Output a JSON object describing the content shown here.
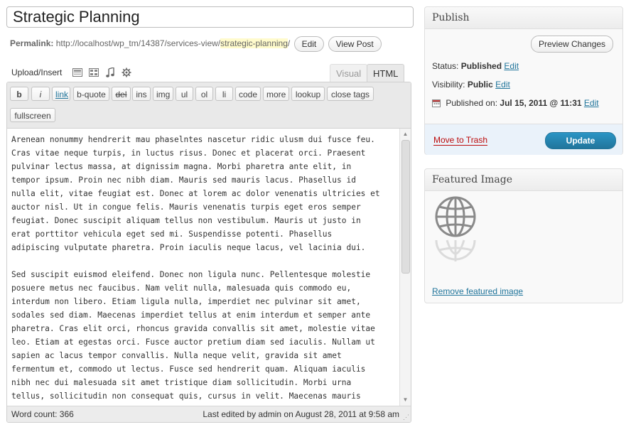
{
  "title": {
    "value": "Strategic Planning"
  },
  "permalink": {
    "label": "Permalink:",
    "base": "http://localhost/wp_tm/14387/services-view/",
    "slug": "strategic-planning",
    "trailing": "/",
    "edit_label": "Edit",
    "view_label": "View Post"
  },
  "media": {
    "label": "Upload/Insert",
    "icons": [
      "image-icon",
      "video-icon",
      "audio-icon",
      "media-gear-icon"
    ]
  },
  "tabs": {
    "visual": "Visual",
    "html": "HTML"
  },
  "quicktags": {
    "b": "b",
    "i": "i",
    "link": "link",
    "bquote": "b-quote",
    "del": "del",
    "ins": "ins",
    "img": "img",
    "ul": "ul",
    "ol": "ol",
    "li": "li",
    "code": "code",
    "more": "more",
    "lookup": "lookup",
    "close": "close tags",
    "fullscreen": "fullscreen"
  },
  "content": {
    "para1": "Arenean nonummy hendrerit mau phaselntes nascetur ridic ulusm dui fusce feu.\nCras vitae neque turpis, in luctus risus. Donec et placerat orci. Praesent\npulvinar lectus massa, at dignissim magna. Morbi pharetra ante elit, in\ntempor ipsum. Proin nec nibh diam. Mauris sed mauris lacus. Phasellus id\nnulla elit, vitae feugiat est. Donec at lorem ac dolor venenatis ultricies et\nauctor nisl. Ut in congue felis. Mauris venenatis turpis eget eros semper\nfeugiat. Donec suscipit aliquam tellus non vestibulum. Mauris ut justo in\nerat porttitor vehicula eget sed mi. Suspendisse potenti. Phasellus\nadipiscing vulputate pharetra. Proin iaculis neque lacus, vel lacinia dui.",
    "para2": "Sed suscipit euismod eleifend. Donec non ligula nunc. Pellentesque molestie\nposuere metus nec faucibus. Nam velit nulla, malesuada quis commodo eu,\ninterdum non libero. Etiam ligula nulla, imperdiet nec pulvinar sit amet,\nsodales sed diam. Maecenas imperdiet tellus at enim interdum et semper ante\npharetra. Cras elit orci, rhoncus gravida convallis sit amet, molestie vitae\nleo. Etiam at egestas orci. Fusce auctor pretium diam sed iaculis. Nullam ut\nsapien ac lacus tempor convallis. Nulla neque velit, gravida sit amet\nfermentum et, commodo ut lectus. Fusce sed hendrerit quam. Aliquam iaculis\nnibh nec dui malesuada sit amet tristique diam sollicitudin. Morbi urna\ntellus, sollicitudin non consequat quis, cursus in velit. Maecenas mauris"
  },
  "status_bar": {
    "word_count": "Word count: 366",
    "last_edited": "Last edited by admin on August 28, 2011 at 9:58 am"
  },
  "publish": {
    "header": "Publish",
    "preview_label": "Preview Changes",
    "status_label": "Status:",
    "status_value": "Published",
    "visibility_label": "Visibility:",
    "visibility_value": "Public",
    "published_label": "Published on:",
    "published_value": "Jul 15, 2011 @ 11:31",
    "edit_label": "Edit",
    "trash_label": "Move to Trash",
    "update_label": "Update"
  },
  "featured_image": {
    "header": "Featured Image",
    "remove_label": "Remove featured image"
  },
  "colors": {
    "link": "#21759b",
    "trash": "#bc0b0b",
    "update": "#21759b"
  }
}
